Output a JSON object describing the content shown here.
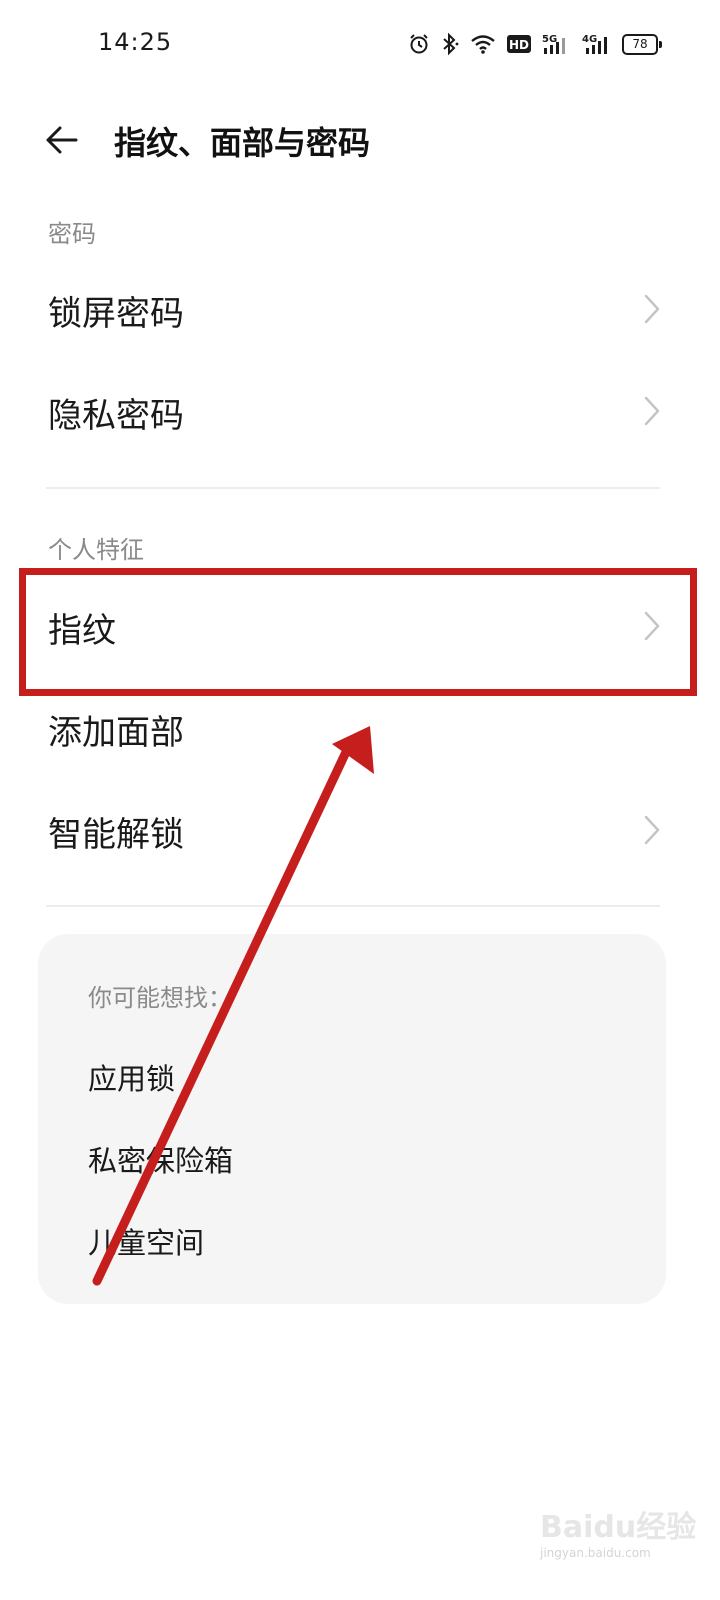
{
  "status_bar": {
    "time": "14:25",
    "icons": [
      "alarm-icon",
      "bluetooth-icon",
      "wifi-icon",
      "hd-icon",
      "5g-signal-icon",
      "4g-signal-icon"
    ],
    "network_5g": "5G",
    "network_4g": "4G",
    "hd": "HD",
    "battery": "78"
  },
  "header": {
    "title": "指纹、面部与密码",
    "back_icon": "arrow-left-icon"
  },
  "sections": {
    "password": {
      "label": "密码",
      "items": [
        {
          "label": "锁屏密码",
          "chevron": true
        },
        {
          "label": "隐私密码",
          "chevron": true
        }
      ]
    },
    "biometrics": {
      "label": "个人特征",
      "items": [
        {
          "label": "指纹",
          "chevron": true
        },
        {
          "label": "添加面部",
          "chevron": false
        },
        {
          "label": "智能解锁",
          "chevron": true
        }
      ]
    }
  },
  "suggestions": {
    "title": "你可能想找：",
    "items": [
      "应用锁",
      "私密保险箱",
      "儿童空间"
    ]
  },
  "annotation": {
    "highlight_color": "#c61d1d"
  },
  "watermark": {
    "logo": "Baidu经验",
    "url": "jingyan.baidu.com"
  }
}
